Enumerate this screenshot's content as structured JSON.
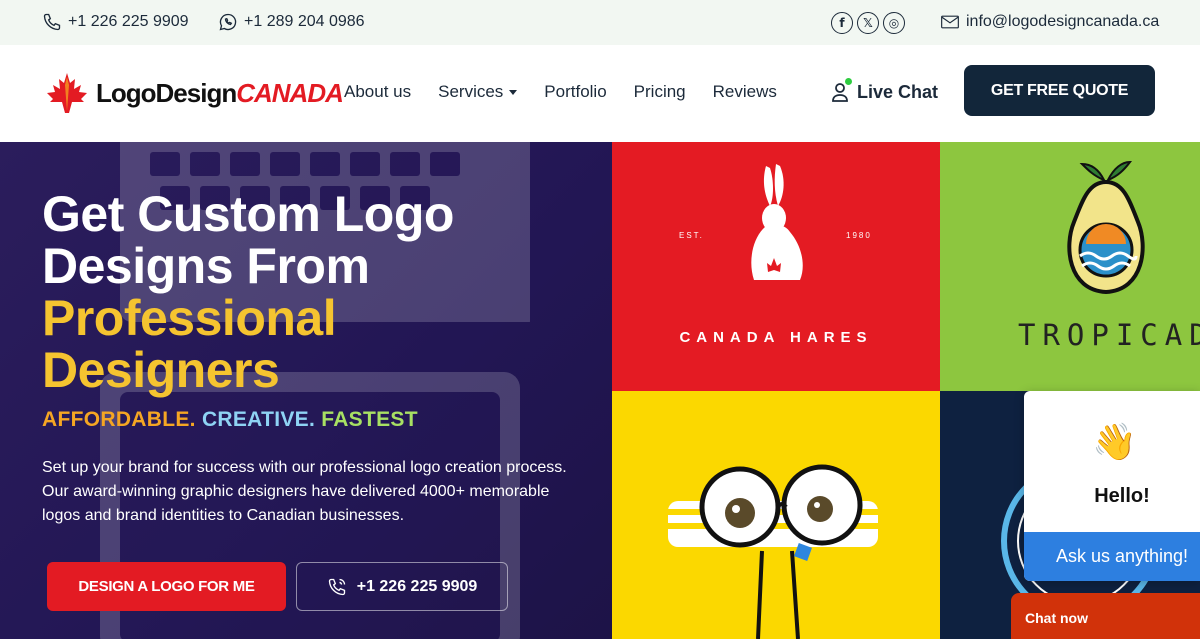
{
  "topbar": {
    "phone_1": "+1 226 225 9909",
    "phone_2": "+1 289 204 0986",
    "email": "info@logodesigncanada.ca",
    "social": [
      "f",
      "𝕏",
      "◎"
    ]
  },
  "header": {
    "logo_part_1": "LogoDesign",
    "logo_part_2": "CANADA",
    "nav": [
      "About us",
      "Services",
      "Portfolio",
      "Pricing",
      "Reviews"
    ],
    "live_chat": "Live Chat",
    "quote_button": "GET FREE QUOTE"
  },
  "hero": {
    "title_line_1": "Get Custom Logo",
    "title_line_2": "Designs From",
    "title_line_3": "Professional",
    "title_line_4": "Designers",
    "tagline_1": "AFFORDABLE.",
    "tagline_2": "CREATIVE.",
    "tagline_3": "FASTEST",
    "description": "Set up your brand for success with our professional logo creation process. Our award-winning graphic designers have delivered 4000+ memorable logos and brand identities to Canadian businesses.",
    "design_button": "DESIGN A LOGO FOR ME",
    "phone_button": "+1 226 225 9909"
  },
  "portfolio": {
    "tile_1_name": "CANADA HARES",
    "tile_1_est": "EST.",
    "tile_1_year": "1980",
    "tile_2_name": "TROPICADO"
  },
  "chat_widget": {
    "greeting": "Hello!",
    "prompt": "Ask us anything!",
    "chat_now": "Chat now"
  },
  "colors": {
    "brand_red": "#e31b23",
    "navy": "#12263a",
    "hero_bg": "#2b1d5c",
    "highlight_yellow": "#f5c430"
  }
}
